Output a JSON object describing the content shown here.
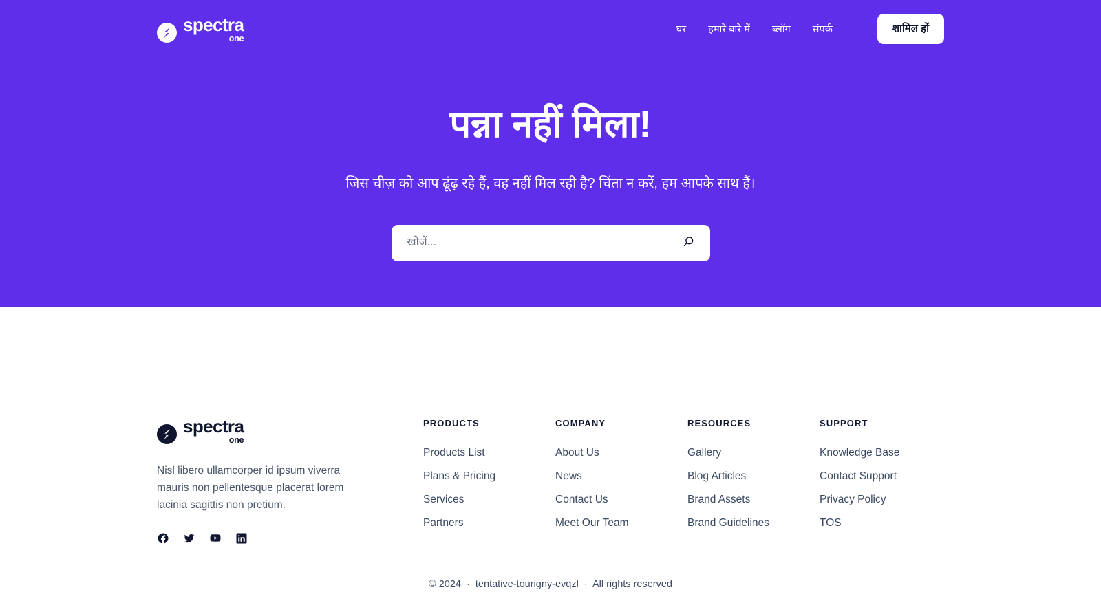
{
  "brand": {
    "name": "spectra",
    "sub": "one",
    "mark_icon": "spectra-circle-s-logo"
  },
  "nav": {
    "items": [
      {
        "label": "घर",
        "name": "nav-link-home"
      },
      {
        "label": "हमारे बारे में",
        "name": "nav-link-about"
      },
      {
        "label": "ब्लॉग",
        "name": "nav-link-blog"
      },
      {
        "label": "संपर्क",
        "name": "nav-link-contact"
      }
    ],
    "cta_label": "शामिल हों"
  },
  "hero": {
    "title": "पन्ना नहीं मिला!",
    "subtitle": "जिस चीज़ को आप ढूंढ़ रहे हैं, वह नहीं मिल रही है? चिंता न करें, हम आपके साथ हैं।",
    "background_color": "#5f2eea",
    "text_color": "#ffffff"
  },
  "search": {
    "value": "",
    "placeholder": "खोजें...",
    "icon": "search-icon"
  },
  "footer": {
    "description": "Nisl libero ullamcorper id ipsum viverra mauris non pellentesque placerat lorem lacinia sagittis non pretium.",
    "socials": [
      {
        "name": "facebook-icon",
        "label": "Facebook"
      },
      {
        "name": "twitter-icon",
        "label": "Twitter"
      },
      {
        "name": "youtube-icon",
        "label": "YouTube"
      },
      {
        "name": "linkedin-icon",
        "label": "LinkedIn"
      }
    ],
    "columns": [
      {
        "title": "PRODUCTS",
        "links": [
          "Products List",
          "Plans & Pricing",
          "Services",
          "Partners"
        ]
      },
      {
        "title": "COMPANY",
        "links": [
          "About Us",
          "News",
          "Contact Us",
          "Meet Our Team"
        ]
      },
      {
        "title": "RESOURCES",
        "links": [
          "Gallery",
          "Blog Articles",
          "Brand Assets",
          "Brand Guidelines"
        ]
      },
      {
        "title": "SUPPORT",
        "links": [
          "Knowledge Base",
          "Contact Support",
          "Privacy Policy",
          "TOS"
        ]
      }
    ],
    "copyright": {
      "symbol": "©",
      "year": "2024",
      "site": "tentative-tourigny-evqzl",
      "rights": "All rights reserved"
    }
  }
}
